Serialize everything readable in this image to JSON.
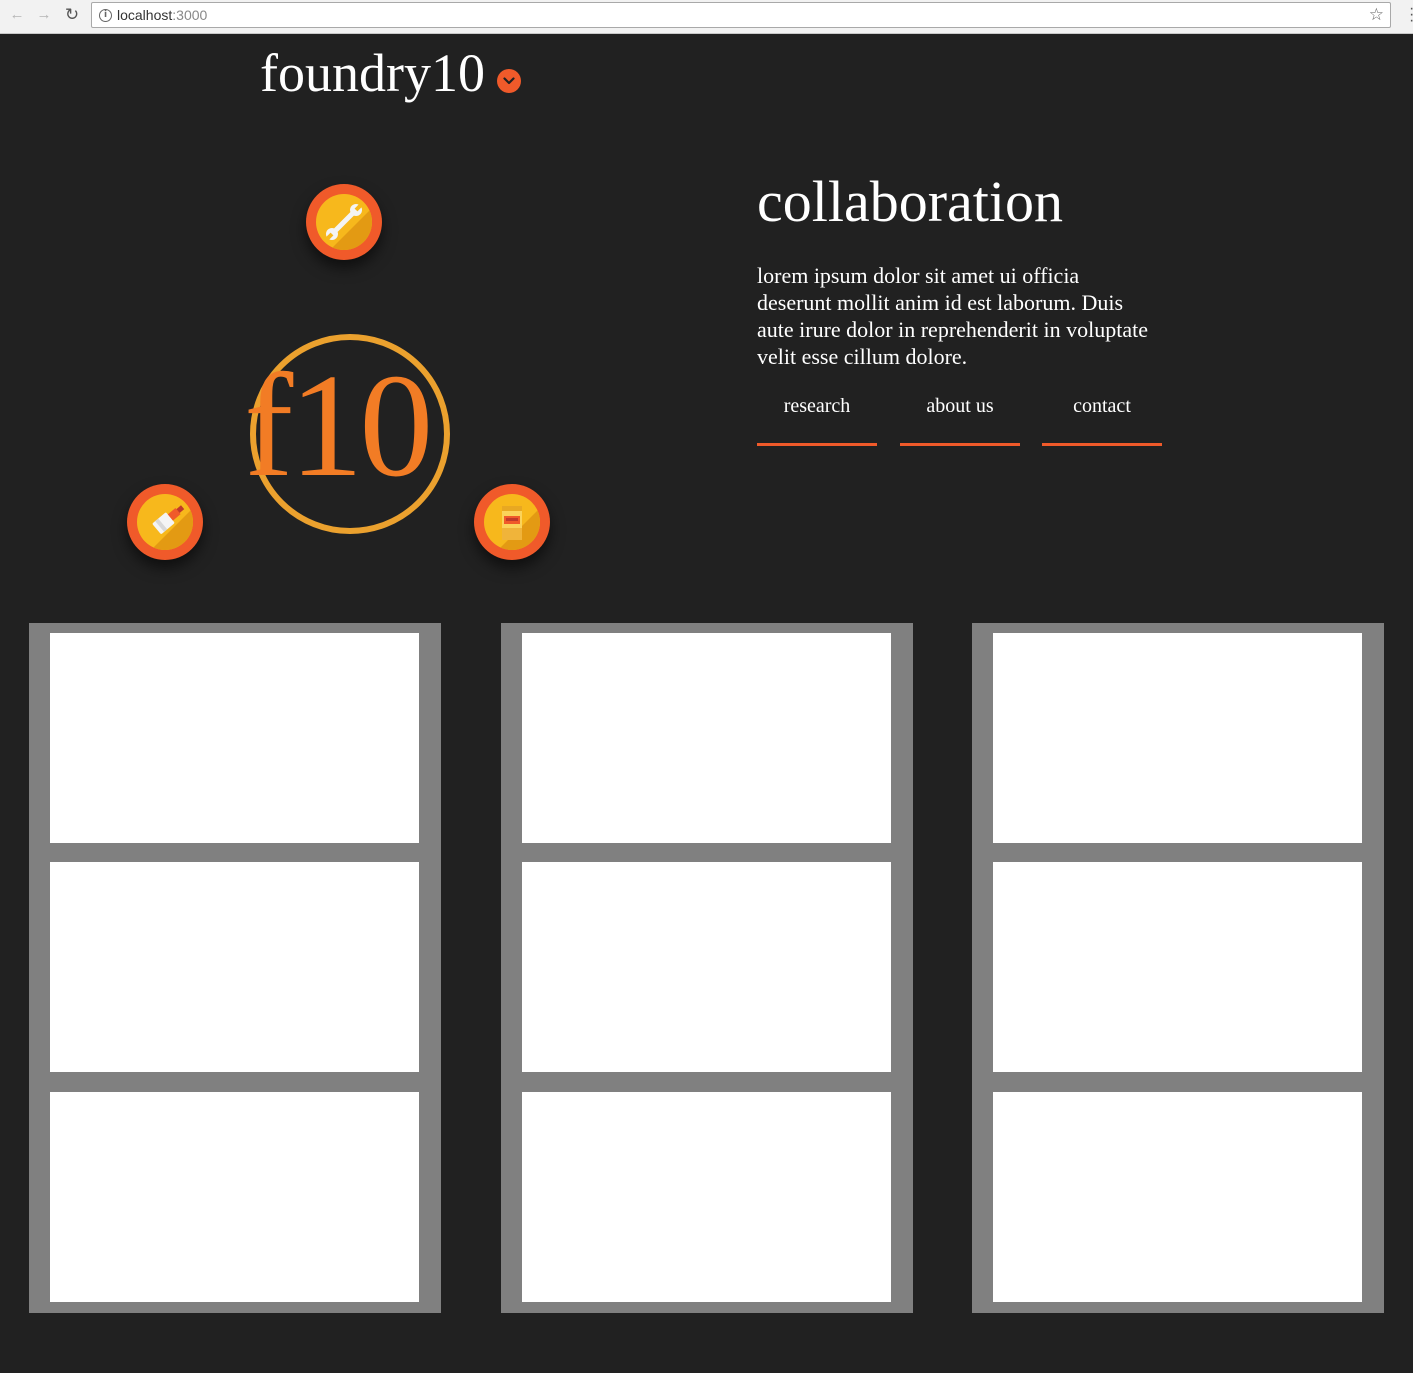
{
  "browser": {
    "url_host": "localhost",
    "url_port": ":3000",
    "info_icon": "info-icon",
    "star_icon": "bookmark-star-icon"
  },
  "header": {
    "brand": "foundry10",
    "toggle_icon": "chevron-down-icon"
  },
  "logo": {
    "text": "f10",
    "ring_color": "#eba12e",
    "text_color": "#f27c25"
  },
  "orbit_icons": [
    {
      "name": "wrench-icon"
    },
    {
      "name": "paint-brush-icon"
    },
    {
      "name": "jar-icon"
    }
  ],
  "hero": {
    "title": "collaboration",
    "body": "lorem ipsum dolor sit amet ui officia deserunt mollit anim id est laborum. Duis aute irure dolor in reprehenderit in voluptate velit esse cillum dolore.",
    "nav": [
      "research",
      "about us",
      "contact"
    ]
  },
  "colors": {
    "background": "#212121",
    "accent": "#f05a2a",
    "column": "#808080",
    "card": "#ffffff"
  },
  "grid": {
    "columns": 3,
    "cards_per_column": 3
  }
}
